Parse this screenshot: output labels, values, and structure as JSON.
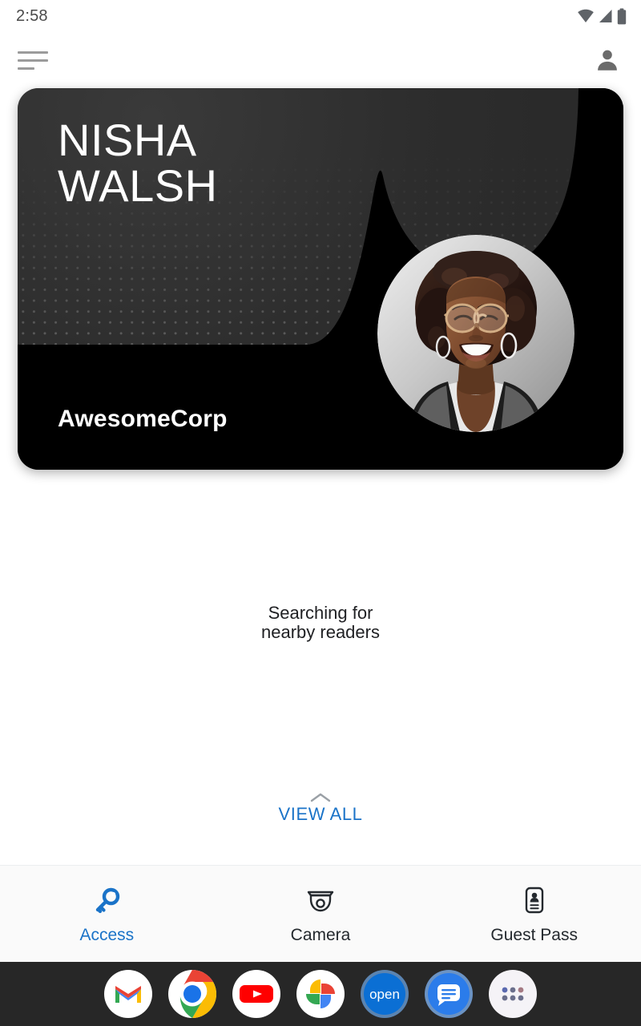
{
  "statusbar": {
    "time": "2:58",
    "icons": [
      "wifi-icon",
      "cell-signal-icon",
      "battery-icon"
    ]
  },
  "appbar": {
    "menu_icon": "hamburger-menu-icon",
    "profile_icon": "person-avatar-icon"
  },
  "badge_card": {
    "name": "NISHA\nWALSH",
    "organization": "AwesomeCorp",
    "avatar_name": "nisha-walsh-photo",
    "background_color": "#2b2b2b",
    "lower_color": "#000000"
  },
  "main": {
    "status_message": "Searching for\nnearby readers",
    "view_all": {
      "label": "VIEW ALL",
      "chevron_icon": "chevron-up-icon",
      "color": "#1a73c8"
    }
  },
  "tabs": [
    {
      "label": "Access",
      "icon": "key-icon",
      "active": true,
      "color": "#1a73c8"
    },
    {
      "label": "Camera",
      "icon": "dome-camera-icon",
      "active": false,
      "color": "#24292e"
    },
    {
      "label": "Guest Pass",
      "icon": "id-card-icon",
      "active": false,
      "color": "#24292e"
    }
  ],
  "dock": [
    {
      "name": "gmail-app-icon",
      "label": "Gmail"
    },
    {
      "name": "chrome-app-icon",
      "label": "Chrome"
    },
    {
      "name": "youtube-app-icon",
      "label": "YouTube"
    },
    {
      "name": "google-photos-app-icon",
      "label": "Photos"
    },
    {
      "name": "open-app-icon",
      "label": "open"
    },
    {
      "name": "messages-app-icon",
      "label": "Messages"
    },
    {
      "name": "app-drawer-icon",
      "label": "All apps"
    }
  ]
}
